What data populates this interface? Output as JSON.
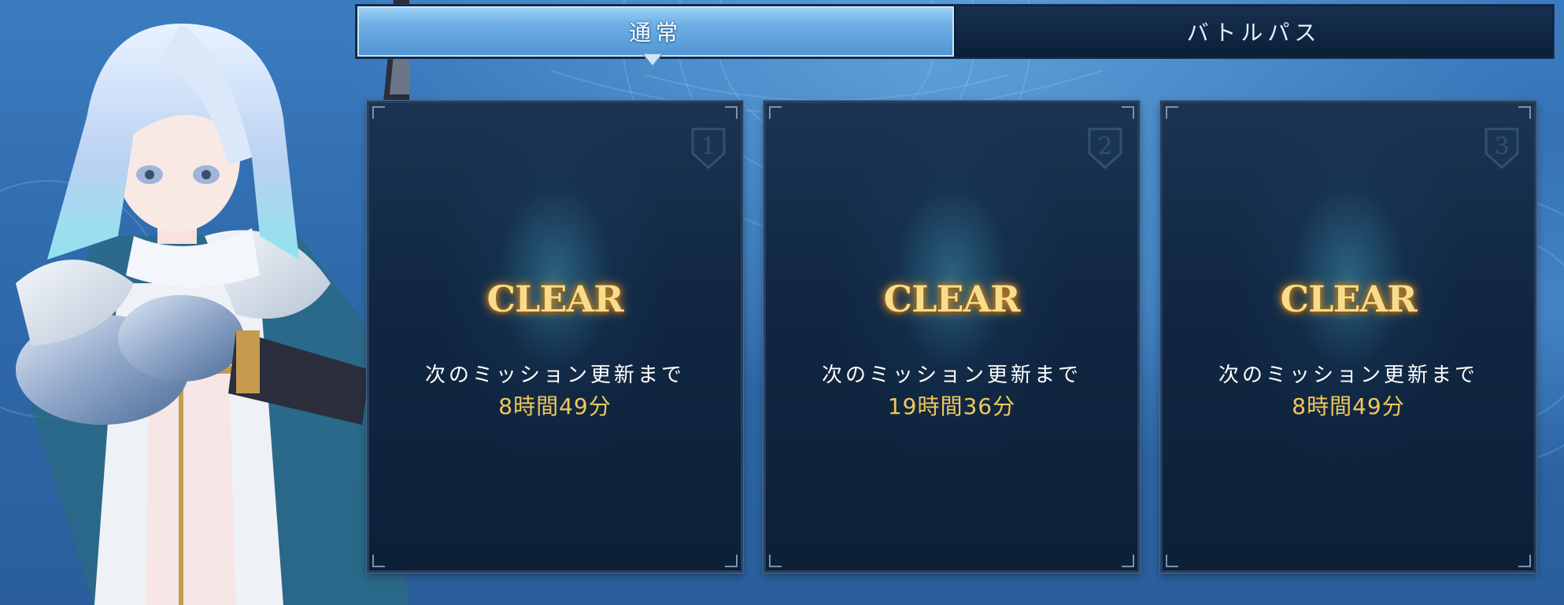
{
  "tabs": [
    {
      "label": "通常",
      "active": true
    },
    {
      "label": "バトルパス",
      "active": false
    }
  ],
  "missions": [
    {
      "number": "1",
      "status": "CLEAR",
      "next_label": "次のミッション更新まで",
      "time_left": "8時間49分"
    },
    {
      "number": "2",
      "status": "CLEAR",
      "next_label": "次のミッション更新まで",
      "time_left": "19時間36分"
    },
    {
      "number": "3",
      "status": "CLEAR",
      "next_label": "次のミッション更新まで",
      "time_left": "8時間49分"
    }
  ],
  "colors": {
    "accent_gold": "#f2c85a",
    "tab_active": "#6fb0e6",
    "card_bg": "#112742",
    "background": "#2f6aab"
  }
}
